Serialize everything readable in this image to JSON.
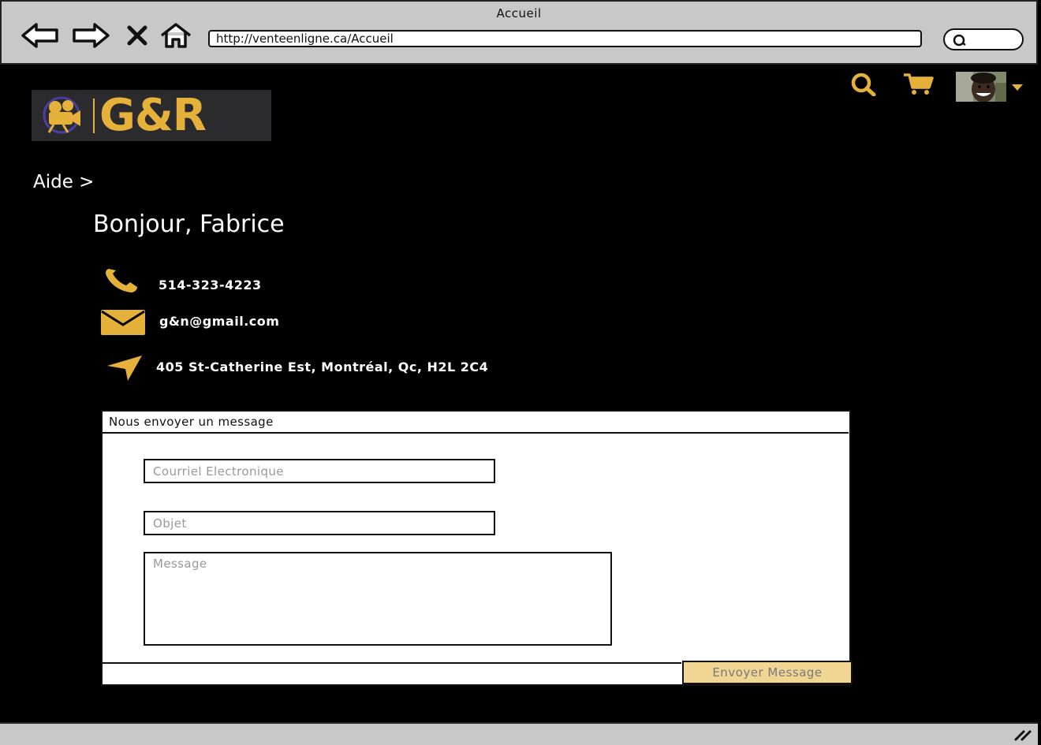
{
  "window": {
    "title": "Accueil",
    "url": "http://venteenligne.ca/Accueil"
  },
  "nav": {
    "back_icon": "arrow-left-icon",
    "forward_icon": "arrow-right-icon",
    "close_icon": "close-icon",
    "home_icon": "home-icon"
  },
  "header": {
    "logo_text": "G&R",
    "search_icon": "search-icon",
    "cart_icon": "cart-icon",
    "avatar_caret": "caret-down-icon"
  },
  "breadcrumb": "Aide >",
  "greeting": "Bonjour, Fabrice",
  "contact": {
    "phone": "514-323-4223",
    "email": "g&n@gmail.com",
    "address": "405 St-Catherine Est, Montréal, Qc, H2L 2C4"
  },
  "message_form": {
    "title": "Nous envoyer un message",
    "email_placeholder": "Courriel Electronique",
    "subject_placeholder": "Objet",
    "message_placeholder": "Message",
    "submit_label": "Envoyer Message"
  },
  "colors": {
    "accent": "#e6b13a",
    "button_bg": "#f1d592",
    "chrome": "#c8c8c8",
    "page_bg": "#000000"
  }
}
